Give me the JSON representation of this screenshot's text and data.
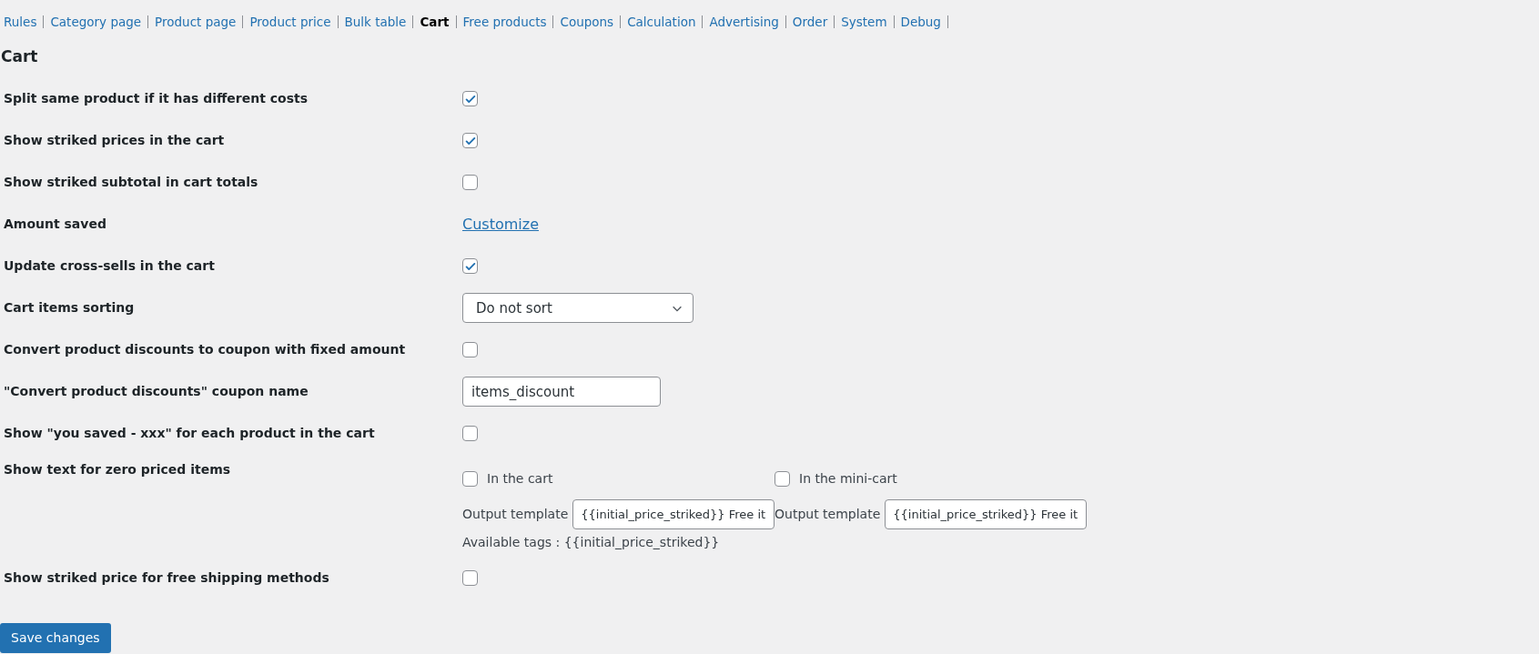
{
  "nav": [
    {
      "label": "Rules",
      "selected": false
    },
    {
      "label": "Category page",
      "selected": false
    },
    {
      "label": "Product page",
      "selected": false
    },
    {
      "label": "Product price",
      "selected": false
    },
    {
      "label": "Bulk table",
      "selected": false
    },
    {
      "label": "Cart",
      "selected": true
    },
    {
      "label": "Free products",
      "selected": false
    },
    {
      "label": "Coupons",
      "selected": false
    },
    {
      "label": "Calculation",
      "selected": false
    },
    {
      "label": "Advertising",
      "selected": false
    },
    {
      "label": "Order",
      "selected": false
    },
    {
      "label": "System",
      "selected": false
    },
    {
      "label": "Debug",
      "selected": false
    }
  ],
  "heading": "Cart",
  "rows": [
    {
      "kind": "checkbox",
      "label": "Split same product if it has different costs",
      "checked": true
    },
    {
      "kind": "checkbox",
      "label": "Show striked prices in the cart",
      "checked": true
    },
    {
      "kind": "checkbox",
      "label": "Show striked subtotal in cart totals",
      "checked": false
    },
    {
      "kind": "link",
      "label": "Amount saved",
      "link": "Customize"
    },
    {
      "kind": "checkbox",
      "label": "Update cross-sells in the cart",
      "checked": true
    },
    {
      "kind": "select",
      "label": "Cart items sorting",
      "value": "Do not sort"
    },
    {
      "kind": "checkbox",
      "label": "Convert product discounts to coupon with fixed amount",
      "checked": false
    },
    {
      "kind": "text",
      "label": "\"Convert product discounts\" coupon name",
      "value": "items_discount"
    },
    {
      "kind": "checkbox",
      "label": "Show \"you saved - xxx\" for each product in the cart",
      "checked": false
    },
    {
      "kind": "zero_priced",
      "label": "Show text for zero priced items",
      "options": [
        {
          "label": "In the cart",
          "checked": false,
          "template_label": "Output template",
          "template_value": "{{initial_price_striked}} Free it"
        },
        {
          "label": "In the mini-cart",
          "checked": false,
          "template_label": "Output template",
          "template_value": "{{initial_price_striked}} Free it"
        }
      ],
      "note": "Available tags : {{initial_price_striked}}"
    },
    {
      "kind": "checkbox",
      "label": "Show striked price for free shipping methods",
      "checked": false
    }
  ],
  "save_button": "Save changes"
}
